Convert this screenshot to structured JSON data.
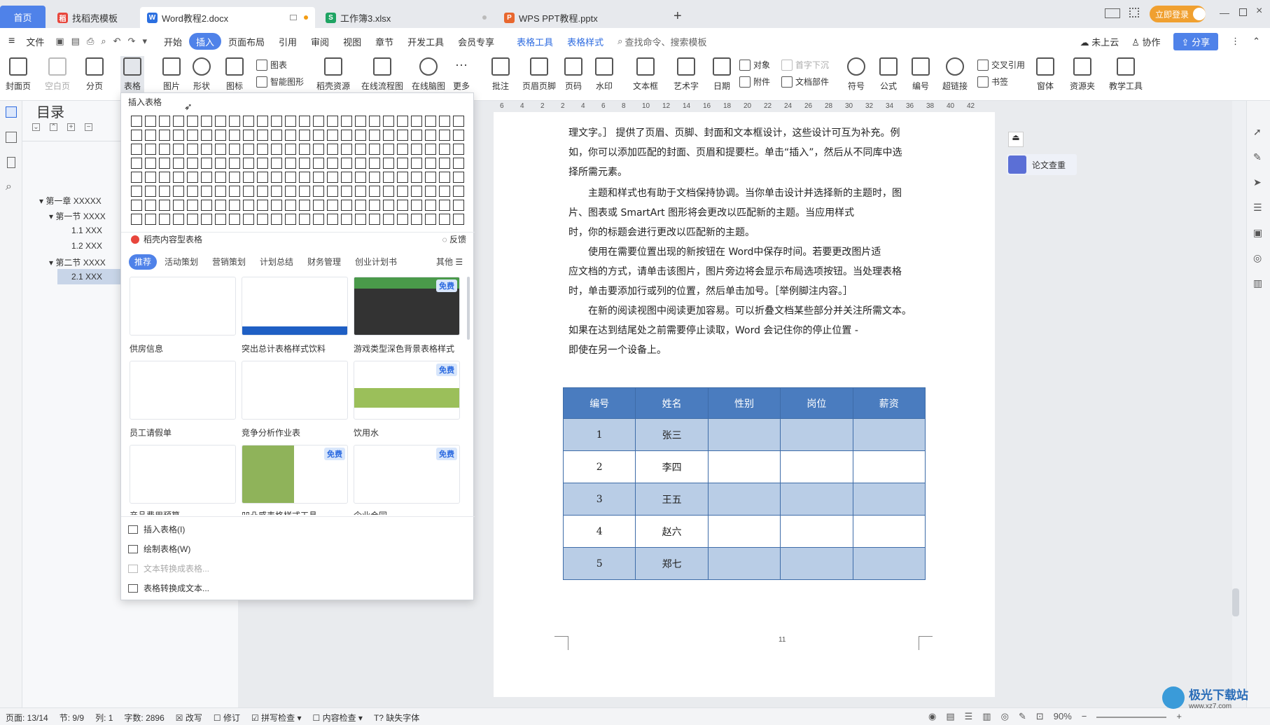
{
  "tabs": {
    "home": "首页",
    "template": "找稻壳模板",
    "word": "Word教程2.docx",
    "excel": "工作簿3.xlsx",
    "ppt": "WPS PPT教程.pptx",
    "login": "立即登录"
  },
  "menu": {
    "file": "文件",
    "items": [
      "开始",
      "插入",
      "页面布局",
      "引用",
      "审阅",
      "视图",
      "章节",
      "开发工具",
      "会员专享",
      "表格工具",
      "表格样式"
    ],
    "search": "查找命令、搜索模板",
    "cloud": "未上云",
    "collab": "协作",
    "share": "分享"
  },
  "ribbon": {
    "cover": "封面页",
    "blank": "空白页",
    "pagebreak": "分页",
    "table": "表格",
    "picture": "图片",
    "shape": "形状",
    "icon": "图标",
    "chart": "图表",
    "smartart": "智能图形",
    "docer": "稻壳资源",
    "flow": "在线流程图",
    "mind": "在线脑图",
    "more": "更多",
    "comment": "批注",
    "header": "页眉页脚",
    "pagenum": "页码",
    "watermark": "水印",
    "textbox": "文本框",
    "wordart": "艺术字",
    "date": "日期",
    "object": "对象",
    "attach": "附件",
    "dropcap": "首字下沉",
    "docpart": "文档部件",
    "symbol": "符号",
    "formula": "公式",
    "number": "编号",
    "crossref": "交叉引用",
    "hyperlink": "超链接",
    "bookmark": "书签",
    "font": "窗体",
    "resource": "资源夹",
    "teach": "教学工具"
  },
  "toc": {
    "title": "目录",
    "items": [
      "第一章 XXXXX",
      "第一节 XXXX",
      "1.1 XXX",
      "1.2 XXX",
      "第二节 XXXX",
      "2.1 XXX"
    ]
  },
  "popup": {
    "title": "插入表格",
    "docer": "稻壳内容型表格",
    "feedback": "反馈",
    "cats": [
      "推荐",
      "活动策划",
      "营销策划",
      "计划总结",
      "财务管理",
      "创业计划书"
    ],
    "other": "其他",
    "free": "免费",
    "templates": [
      "供房信息",
      "突出总计表格样式饮料",
      "游戏类型深色背景表格样式",
      "员工请假单",
      "竞争分析作业表",
      "饮用水",
      "产品费用预算",
      "凹凸感表格样式工具",
      "企业合同"
    ],
    "menu": [
      "插入表格(I)",
      "绘制表格(W)",
      "文本转换成表格...",
      "表格转换成文本..."
    ]
  },
  "ruler": [
    "6",
    "4",
    "2",
    "2",
    "4",
    "6",
    "8",
    "10",
    "12",
    "14",
    "16",
    "18",
    "20",
    "22",
    "24",
    "26",
    "28",
    "30",
    "32",
    "34",
    "36",
    "38",
    "40",
    "42"
  ],
  "doc": {
    "lines": [
      "理文字。］ 提供了页眉、页脚、封面和文本框设计，这些设计可互为补充。例",
      "如，你可以添加匹配的封面、页眉和提要栏。单击“插入”，然后从不同库中选",
      "择所需元素。",
      "主题和样式也有助于文档保持协调。当你单击设计并选择新的主题时，图",
      "片、图表或 SmartArt 图形将会更改以匹配新的主题。当应用样式",
      "时，你的标题会进行更改以匹配新的主题。",
      "使用在需要位置出现的新按钮在 Word中保存时间。若要更改图片适",
      "应文档的方式，请单击该图片，图片旁边将会显示布局选项按钮。当处理表格",
      "时，单击要添加行或列的位置，然后单击加号。［举例脚注内容。］",
      "在新的阅读视图中阅读更加容易。可以折叠文档某些部分并关注所需文本。",
      "如果在达到结尾处之前需要停止读取，Word 会记住你的停止位置 -",
      "即使在另一个设备上。"
    ],
    "table": {
      "headers": [
        "编号",
        "姓名",
        "性别",
        "岗位",
        "薪资"
      ],
      "rows": [
        [
          "1",
          "张三"
        ],
        [
          "2",
          "李四"
        ],
        [
          "3",
          "王五"
        ],
        [
          "4",
          "赵六"
        ],
        [
          "5",
          "郑七"
        ]
      ]
    },
    "pagenum": "11",
    "check": "论文查重"
  },
  "status": {
    "page": "页面: 13/14",
    "section": "节: 9/9",
    "col": "列: 1",
    "words": "字数: 2896",
    "rev": "改写",
    "track": "修订",
    "spell": "拼写检查",
    "content": "内容检查",
    "font": "缺失字体",
    "zoom": "90%"
  },
  "watermark": {
    "brand": "极光下载站",
    "url": "www.xz7.com"
  }
}
